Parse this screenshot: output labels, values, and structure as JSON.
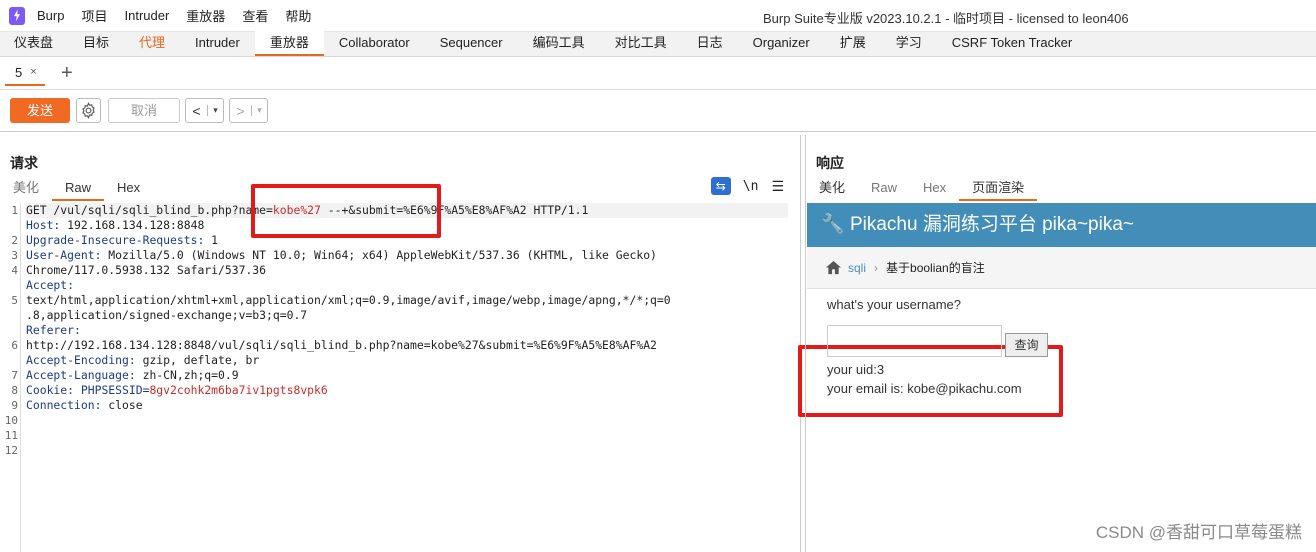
{
  "menubar": {
    "items": [
      "Burp",
      "项目",
      "Intruder",
      "重放器",
      "查看",
      "帮助"
    ],
    "window_title": "Burp Suite专业版  v2023.10.2.1 - 临时项目 - licensed to leon406"
  },
  "main_tabs": [
    {
      "label": "仪表盘"
    },
    {
      "label": "目标"
    },
    {
      "label": "代理"
    },
    {
      "label": "Intruder"
    },
    {
      "label": "重放器"
    },
    {
      "label": "Collaborator"
    },
    {
      "label": "Sequencer"
    },
    {
      "label": "编码工具"
    },
    {
      "label": "对比工具"
    },
    {
      "label": "日志"
    },
    {
      "label": "Organizer"
    },
    {
      "label": "扩展"
    },
    {
      "label": "学习"
    },
    {
      "label": "CSRF Token Tracker"
    }
  ],
  "repeater_tab": {
    "label": "5",
    "close": "×",
    "add": "+"
  },
  "toolbar": {
    "send": "发送",
    "cancel": "取消",
    "back": "<",
    "forward": ">",
    "dropdown": "▾"
  },
  "request": {
    "title": "请求",
    "tabs": [
      "美化",
      "Raw",
      "Hex"
    ],
    "newline_label": "\\n",
    "line_numbers": [
      "1",
      "",
      "2",
      "3",
      "4",
      "",
      "5",
      "",
      "",
      "6",
      "",
      "7",
      "8",
      "9",
      "10",
      "11",
      "12"
    ],
    "lines": [
      {
        "a": "GET /vul/sqli/sqli_blind_b.php?name=",
        "b": "kobe%27",
        "c": " --+&submit=%E6%9F%A5%E8%AF%A2 HTTP/1.1"
      },
      {
        "k": "Host:",
        "r": " 192.168.134.128:8848"
      },
      {
        "k": "Upgrade-Insecure-Requests:",
        "r": " 1"
      },
      {
        "k": "User-Agent:",
        "r": " Mozilla/5.0 (Windows NT 10.0; Win64; x64) AppleWebKit/537.36 (KHTML, like Gecko)"
      },
      {
        "t": "Chrome/117.0.5938.132 Safari/537.36"
      },
      {
        "k": "Accept:",
        "r": ""
      },
      {
        "t": "text/html,application/xhtml+xml,application/xml;q=0.9,image/avif,image/webp,image/apng,*/*;q=0"
      },
      {
        "t": ".8,application/signed-exchange;v=b3;q=0.7"
      },
      {
        "k": "Referer:",
        "r": ""
      },
      {
        "t": "http://192.168.134.128:8848/vul/sqli/sqli_blind_b.php?name=kobe%27&submit=%E6%9F%A5%E8%AF%A2"
      },
      {
        "k": "Accept-Encoding:",
        "r": " gzip, deflate, br"
      },
      {
        "k": "Accept-Language:",
        "r": " zh-CN,zh;q=0.9"
      },
      {
        "k": "Cookie:",
        "ck": " PHPSESSID=",
        "cv": "8gv2cohk2m6ba7iv1pgts8vpk6"
      },
      {
        "k": "Connection:",
        "r": " close"
      },
      {
        "t": ""
      },
      {
        "t": ""
      }
    ]
  },
  "response": {
    "title": "响应",
    "tabs": [
      "美化",
      "Raw",
      "Hex",
      "页面渲染"
    ],
    "page_header": "Pikachu 漏洞练习平台 pika~pika~",
    "breadcrumb_link": "sqli",
    "breadcrumb_current": "基于boolian的盲注",
    "question": "what's your username?",
    "query_button": "查询",
    "uid_line": "your uid:3",
    "email_line": "your email is: kobe@pikachu.com"
  },
  "watermark": "CSDN @香甜可口草莓蛋糕",
  "colors": {
    "accent": "#e8681c",
    "send": "#f06a24",
    "page_header": "#438eb9",
    "highlight_box": "#e21a1a"
  }
}
